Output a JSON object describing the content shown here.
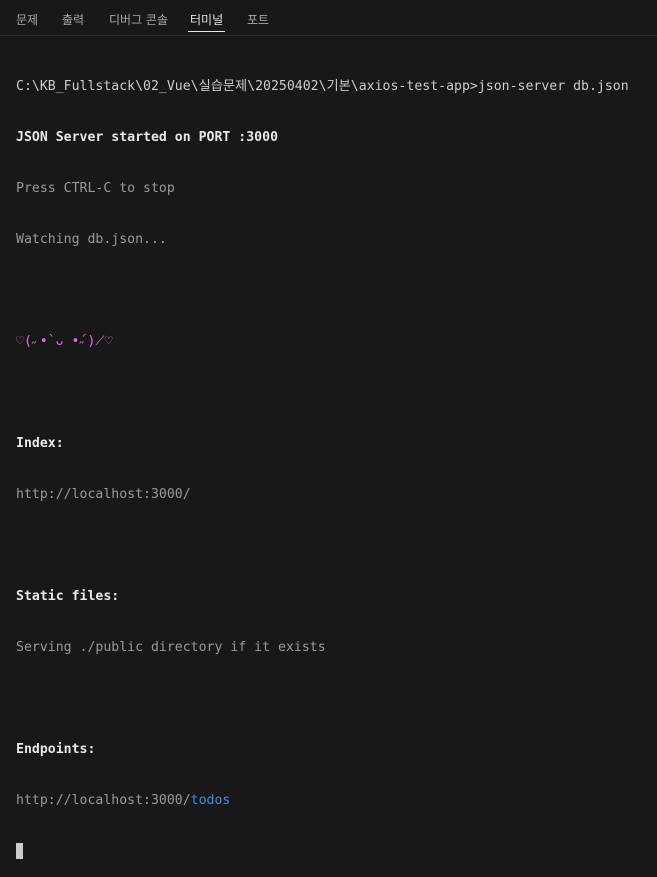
{
  "tabs": [
    {
      "label": "문제"
    },
    {
      "label": "출력"
    },
    {
      "label": "디버그 콘솔"
    },
    {
      "label": "터미널"
    },
    {
      "label": "포트"
    }
  ],
  "terminal": {
    "command_line": "C:\\KB_Fullstack\\02_Vue\\실습문제\\20250402\\기본\\axios-test-app>json-server db.json",
    "started": "JSON Server started on PORT :3000",
    "stop_hint": "Press CTRL-C to stop",
    "watching": "Watching db.json...",
    "kaomoji": "♡(˶•̀ ᴗ •́˶)⟋♡",
    "index_label": "Index:",
    "index_url": "http://localhost:3000/",
    "static_label": "Static files:",
    "static_text": "Serving ./public directory if it exists",
    "endpoints_label": "Endpoints:",
    "endpoint_base": "http://localhost:3000/",
    "endpoint_path": "todos"
  }
}
